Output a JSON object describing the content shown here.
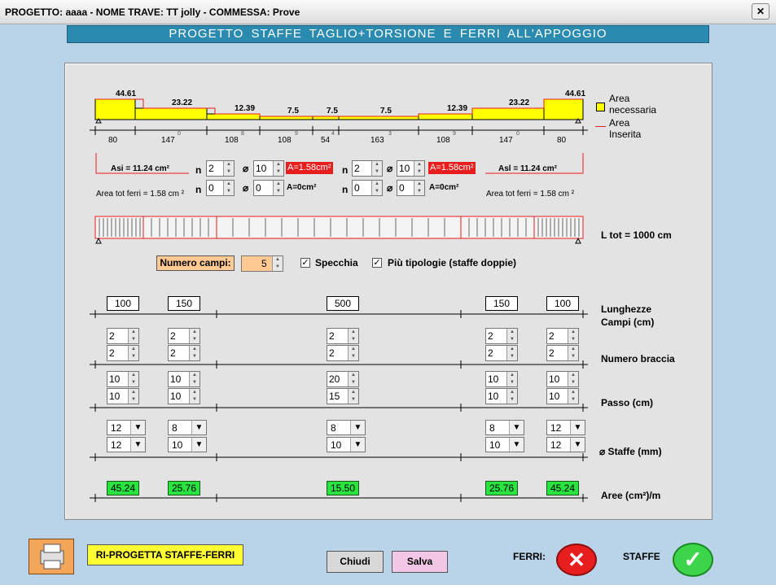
{
  "window": {
    "title": "PROGETTO: aaaa - NOME TRAVE: TT jolly - COMMESSA: Prove",
    "close_glyph": "✕"
  },
  "header": {
    "title": "PROGETTO   STAFFE  TAGLIO+TORSIONE   E   FERRI ALL'APPOGGIO"
  },
  "diagram": {
    "bar_values": [
      "44.61",
      "23.22",
      "12.39",
      "7.5",
      "7.5",
      "7.5",
      "12.39",
      "23.22",
      "44.61"
    ],
    "seg_lengths": [
      "80",
      "147",
      "108",
      "108",
      "54",
      "163",
      "108",
      "147",
      "80"
    ],
    "tick_marks": [
      "0",
      "8",
      "9",
      "4",
      "3",
      "9",
      "0"
    ],
    "legend": {
      "necessaria": "Area necessaria",
      "inserita": "Area Inserita"
    }
  },
  "rebars": {
    "asi_left": "Asi =  11.24 cm²",
    "asi_right": "Asl =  11.24 cm²",
    "area_tot_left": "Area tot ferri = 1.58 cm ²",
    "area_tot_right": "Area tot ferri = 1.58 cm ²",
    "n_label": "n",
    "phi_glyph": "⌀",
    "left": {
      "n1": "2",
      "d1": "10",
      "a1": "A=1.58cm²",
      "n2": "0",
      "d2": "0",
      "a2": "A=0cm²"
    },
    "right": {
      "n1": "2",
      "d1": "10",
      "a1": "A=1.58cm²",
      "n2": "0",
      "d2": "0",
      "a2": "A=0cm²"
    }
  },
  "ltot": "L tot =  1000  cm",
  "controls": {
    "numero_campi_label": "Numero campi:",
    "numero_campi_value": "5",
    "specchia_label": "Specchia",
    "specchia_checked": "✓",
    "piu_tipologie_label": "Più tipologie (staffe doppie)",
    "piu_tipologie_checked": "✓"
  },
  "fields": {
    "lunghezze": [
      "100",
      "150",
      "500",
      "150",
      "100"
    ],
    "braccia_1": [
      "2",
      "2",
      "2",
      "2",
      "2"
    ],
    "braccia_2": [
      "2",
      "2",
      "2",
      "2",
      "2"
    ],
    "passo_1": [
      "10",
      "10",
      "20",
      "10",
      "10"
    ],
    "passo_2": [
      "10",
      "10",
      "15",
      "10",
      "10"
    ],
    "staffe_1": [
      "12",
      "8",
      "8",
      "8",
      "12"
    ],
    "staffe_2": [
      "12",
      "10",
      "10",
      "10",
      "12"
    ],
    "aree": [
      "45.24",
      "25.76",
      "15.50",
      "25.76",
      "45.24"
    ]
  },
  "row_labels": {
    "lunghezze": "Lunghezze Campi (cm)",
    "braccia": "Numero braccia",
    "passo": "Passo  (cm)",
    "staffe": "⌀  Staffe  (mm)",
    "aree": "Aree  (cm²)/m"
  },
  "footer": {
    "riprogetta": "RI-PROGETTA  STAFFE-FERRI",
    "chiudi": "Chiudi",
    "salva": "Salva",
    "ferri_label": "FERRI:",
    "staffe_label": "STAFFE",
    "ferri_status_glyph": "✕",
    "staffe_status_glyph": "✓"
  },
  "colors": {
    "banner": "#2a8ab0",
    "area_bar": "#ffff00",
    "inserted_line": "#e81d1d",
    "ok_green": "#29e33f",
    "riprogetta_bg": "#ffff33",
    "salva_bg": "#f2c7e6",
    "chiudi_bg": "#d8d8d8"
  }
}
